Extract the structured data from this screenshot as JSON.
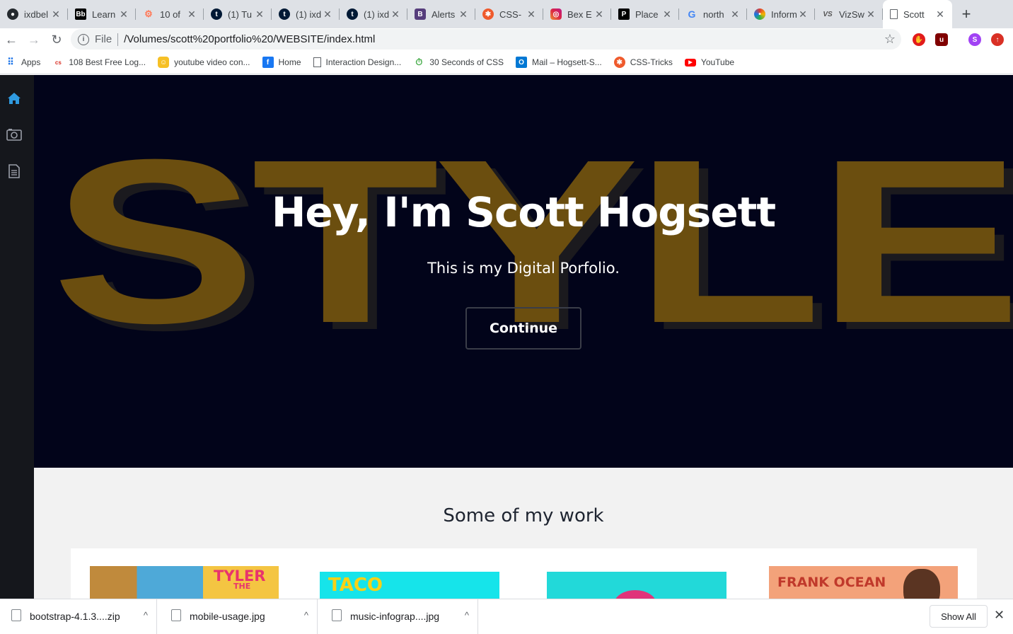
{
  "browser": {
    "tabs": [
      {
        "title": "ixdbel",
        "icon": "github-icon",
        "color": "#24292e"
      },
      {
        "title": "Learn",
        "icon": "blackboard-icon",
        "color": "#000000"
      },
      {
        "title": "10 of",
        "icon": "hubspot-icon",
        "color": "#ff7a59"
      },
      {
        "title": "(1) Tu",
        "icon": "tumblr-icon",
        "color": "#001935"
      },
      {
        "title": "(1) ixd",
        "icon": "tumblr-icon",
        "color": "#001935"
      },
      {
        "title": "(1) ixd",
        "icon": "tumblr-icon",
        "color": "#001935"
      },
      {
        "title": "Alerts",
        "icon": "bootstrap-icon",
        "color": "#563d7c"
      },
      {
        "title": "CSS-",
        "icon": "css-tricks-icon",
        "color": "#ef5a2c"
      },
      {
        "title": "Bex E",
        "icon": "instagram-icon",
        "color": "#c13584"
      },
      {
        "title": "Place",
        "icon": "placeit-icon",
        "color": "#000000"
      },
      {
        "title": "north",
        "icon": "google-icon",
        "color": "#4285f4"
      },
      {
        "title": "Inform",
        "icon": "infogram-icon",
        "color": "#e03c31"
      },
      {
        "title": "VizSw",
        "icon": "vizsweet-icon",
        "color": "#555555"
      },
      {
        "title": "Scott",
        "icon": "document-icon",
        "color": "#5f6368"
      }
    ],
    "address": {
      "scheme": "File",
      "url": "/Volumes/scott%20portfolio%20/WEBSITE/index.html"
    },
    "bookmarks": [
      {
        "label": "Apps",
        "icon": "apps-grid-icon"
      },
      {
        "label": "108 Best Free Log...",
        "icon": "cs-icon"
      },
      {
        "label": "youtube video con...",
        "icon": "chat-emoji-icon"
      },
      {
        "label": "Home",
        "icon": "facebook-icon"
      },
      {
        "label": "Interaction Design...",
        "icon": "page-icon"
      },
      {
        "label": "30 Seconds of CSS",
        "icon": "stopwatch-icon"
      },
      {
        "label": "Mail – Hogsett-S...",
        "icon": "outlook-icon"
      },
      {
        "label": "CSS-Tricks",
        "icon": "css-tricks-icon"
      },
      {
        "label": "YouTube",
        "icon": "youtube-icon"
      }
    ],
    "profile_initial": "S"
  },
  "site": {
    "nav": [
      "home-icon",
      "camera-icon",
      "document-icon"
    ],
    "hero": {
      "background_word": "STYLE",
      "heading": "Hey, I'm Scott Hogsett",
      "subheading": "This is my Digital Porfolio.",
      "button": "Continue"
    },
    "work": {
      "heading": "Some of my work",
      "thumbs": [
        {
          "caption_a": "TYLER",
          "caption_b": "THE"
        },
        {
          "caption_a": "TACO"
        },
        {
          "caption_a": ""
        },
        {
          "caption_a": "FRANK OCEAN"
        }
      ]
    }
  },
  "downloads": {
    "items": [
      "bootstrap-4.1.3....zip",
      "mobile-usage.jpg",
      "music-infograp....jpg"
    ],
    "show_all": "Show All"
  },
  "colors": {
    "hero_bg": "#02041a",
    "word_color": "#6b4e0f",
    "nav_active": "#2f9ae0"
  }
}
